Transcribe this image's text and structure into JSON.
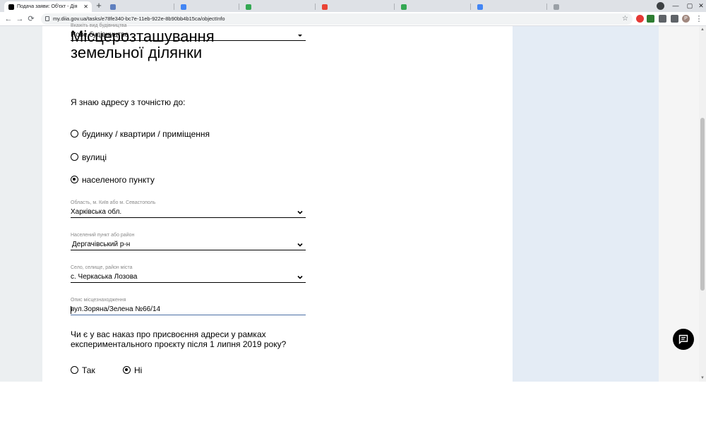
{
  "browser": {
    "active_tab_title": "Подача заяви: Об'єкт - Дія",
    "tab_close": "✕",
    "new_tab": "+",
    "other_tab_colors": [
      "#5f7fbf",
      "#34a853",
      "#4285f4",
      "#ea4335",
      "#34a853",
      "#4285f4",
      "#9aa0a6"
    ],
    "url": "my.diia.gov.ua/tasks/e78fe340-bc7e-11eb-922e-8b90bb4b15ca/objectInfo",
    "back": "←",
    "forward": "→",
    "reload": "⟳",
    "star": "☆",
    "profile_initial": "P",
    "menu": "⋮"
  },
  "form": {
    "building_type": {
      "label": "Вкажіть вид будівництва",
      "value": "Нове будівництво"
    },
    "section_title_line1": "Місцерозташування",
    "section_title_line2": "земельної ділянки",
    "address_precision_question": "Я знаю адресу з точністю до:",
    "address_options": [
      {
        "label": "будинку / квартири / приміщення",
        "selected": false
      },
      {
        "label": "вулиці",
        "selected": false
      },
      {
        "label": "населеного пункту",
        "selected": true
      }
    ],
    "region": {
      "label": "Область, м. Київ або м. Севастополь",
      "value": "Харківська обл."
    },
    "district": {
      "label": "Населений пункт або район",
      "value": "Дергачівський р-н"
    },
    "settlement": {
      "label": "Село, селище, район міста",
      "value": "с. Черкаська Лозова"
    },
    "location_description": {
      "label": "Опис місцезнаходження",
      "value": "вул.Зоряна/Зелена №66/14"
    },
    "experimental_question_line1": "Чи є у вас наказ про присвоєння адреси у рамках",
    "experimental_question_line2": "експериментального проєкту після 1 липня 2019 року?",
    "experimental_options": [
      {
        "label": "Так",
        "selected": false
      },
      {
        "label": "Ні",
        "selected": true
      }
    ]
  },
  "colors": {
    "page_accent_panel": "#e4ecf5",
    "active_input_underline": "#4a6fa5"
  }
}
